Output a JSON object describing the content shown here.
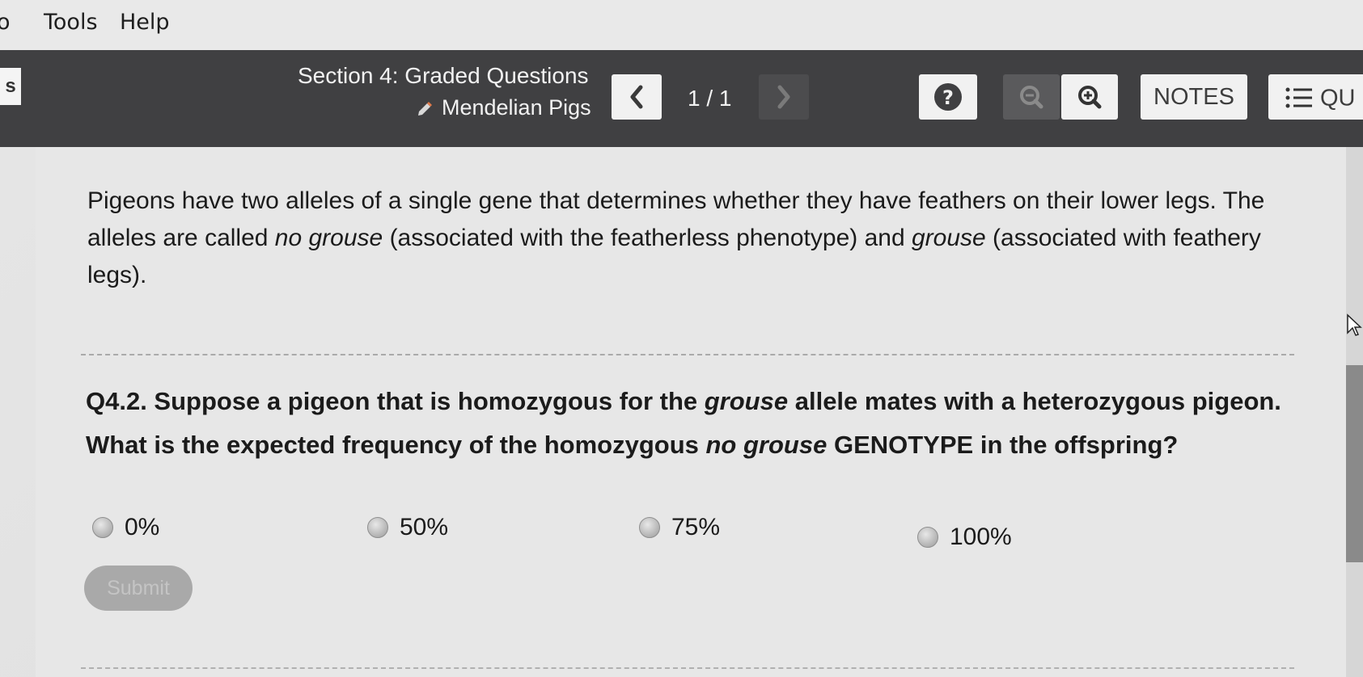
{
  "menubar": {
    "fragment": "o",
    "tools": "Tools",
    "help": "Help"
  },
  "toolbar": {
    "left_stub": "s",
    "section_title": "Section 4: Graded Questions",
    "assignment": "Mendelian Pigs",
    "page_count": "1 / 1",
    "notes_label": "NOTES",
    "quiz_label": "QU"
  },
  "passage": {
    "part1": "Pigeons have two alleles of a single gene that determines whether they have feathers on their lower legs. The alleles are called ",
    "em1": "no grouse",
    "part2": " (associated with the featherless phenotype) and ",
    "em2": "grouse",
    "part3": " (associated with feathery legs)."
  },
  "question": {
    "part1": "Q4.2. Suppose a pigeon that is homozygous for the ",
    "em1": "grouse",
    "part2": " allele mates with a heterozygous pigeon. What is the expected frequency of the homozygous ",
    "em2": "no grouse",
    "part3": " GENOTYPE in the offspring?"
  },
  "options": [
    "0%",
    "50%",
    "75%",
    "100%"
  ],
  "submit_label": "Submit"
}
